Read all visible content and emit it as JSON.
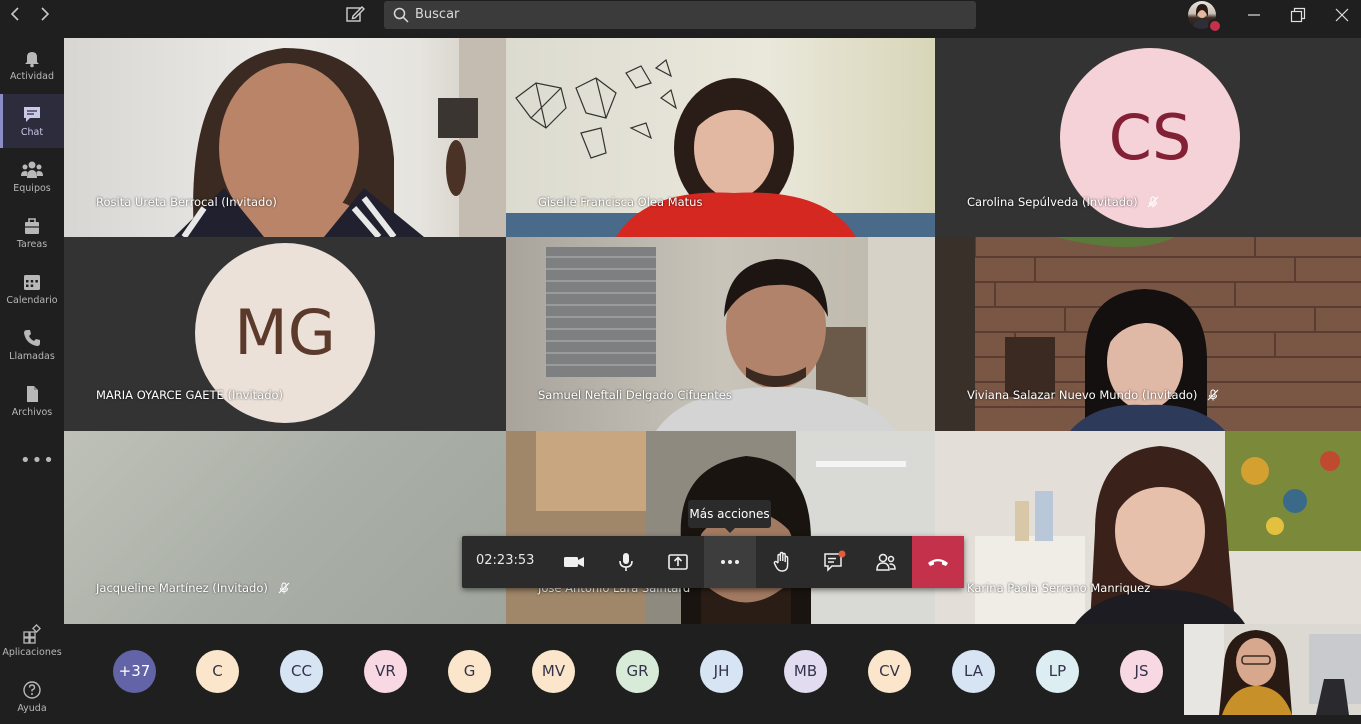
{
  "search": {
    "placeholder": "Buscar"
  },
  "rail": {
    "items": [
      {
        "label": "Actividad"
      },
      {
        "label": "Chat"
      },
      {
        "label": "Equipos"
      },
      {
        "label": "Tareas"
      },
      {
        "label": "Calendario"
      },
      {
        "label": "Llamadas"
      },
      {
        "label": "Archivos"
      }
    ],
    "more": "•••",
    "bottom": [
      {
        "label": "Aplicaciones"
      },
      {
        "label": "Ayuda"
      }
    ]
  },
  "tiles": [
    {
      "name": "Rosita Ureta Berrocal (Invitado)"
    },
    {
      "name": "Giselle Francisca Olea Matus"
    },
    {
      "name": "Carolina Sepúlveda (Invitado)",
      "initials": "CS"
    },
    {
      "name": "MARIA OYARCE GAETE (Invitado)",
      "initials": "MG"
    },
    {
      "name": "Samuel Neftali Delgado Cifuentes"
    },
    {
      "name": "Viviana Salazar Nuevo Mundo (Invitado)"
    },
    {
      "name": "Jacqueline Martínez (Invitado)"
    },
    {
      "name": "José Antonio Lara Saintard"
    },
    {
      "name": "Karina Paola Serrano Manriquez"
    }
  ],
  "toolbar": {
    "timer": "02:23:53",
    "tooltip": "Más acciones"
  },
  "strip": {
    "overflow": "+37",
    "avatars": [
      "C",
      "CC",
      "VR",
      "G",
      "MV",
      "GR",
      "JH",
      "MB",
      "CV",
      "LA",
      "LP",
      "JS"
    ]
  },
  "colors": {
    "accent": "#8b8cc7",
    "hangup": "#c4314b",
    "cs_bg": "#f5d1d8",
    "cs_fg": "#822035",
    "mg_bg": "#ece1d8",
    "mg_fg": "#5b3a2c"
  }
}
